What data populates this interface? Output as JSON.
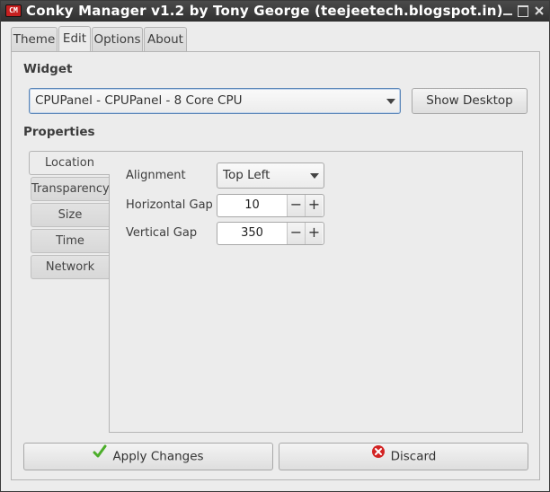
{
  "window": {
    "title": "Conky Manager v1.2 by Tony George (teejeetech.blogspot.in)",
    "icon_text": "CM"
  },
  "tabs": [
    {
      "label": "Theme"
    },
    {
      "label": "Edit",
      "active": true
    },
    {
      "label": "Options"
    },
    {
      "label": "About"
    }
  ],
  "widget": {
    "section_label": "Widget",
    "selected": "CPUPanel - CPUPanel - 8 Core CPU",
    "show_desktop_label": "Show Desktop"
  },
  "properties": {
    "section_label": "Properties",
    "tabs": [
      {
        "label": "Location",
        "active": true
      },
      {
        "label": "Transparency"
      },
      {
        "label": "Size"
      },
      {
        "label": "Time"
      },
      {
        "label": "Network"
      }
    ],
    "alignment_label": "Alignment",
    "alignment_value": "Top Left",
    "hgap_label": "Horizontal Gap",
    "hgap_value": "10",
    "vgap_label": "Vertical Gap",
    "vgap_value": "350",
    "minus_glyph": "−",
    "plus_glyph": "+"
  },
  "actions": {
    "apply_label": "Apply Changes",
    "discard_label": "Discard"
  },
  "colors": {
    "titlebar": "#383838",
    "apply_icon": "#4cae2a",
    "discard_icon": "#d32323"
  }
}
